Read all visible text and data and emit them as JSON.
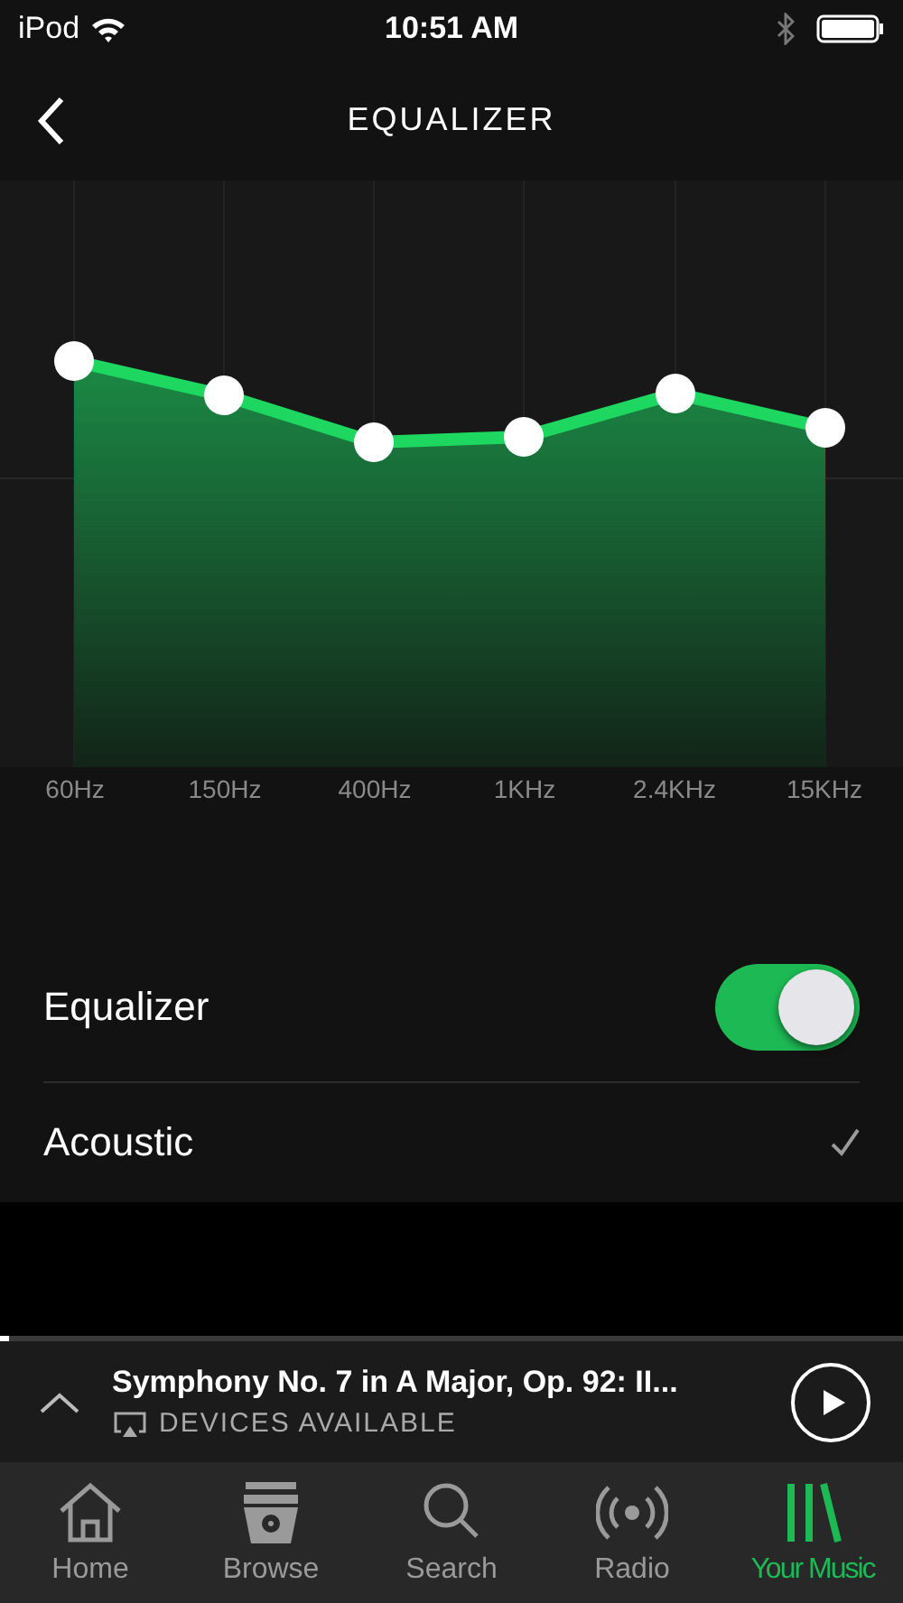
{
  "status_bar": {
    "carrier": "iPod",
    "time": "10:51 AM"
  },
  "nav": {
    "title": "EQUALIZER"
  },
  "bands": [
    "60Hz",
    "150Hz",
    "400Hz",
    "1KHz",
    "2.4KHz",
    "15KHz"
  ],
  "settings": [
    {
      "kind": "toggle",
      "label": "Equalizer",
      "on": true
    },
    {
      "kind": "preset",
      "label": "Acoustic",
      "checked": true
    }
  ],
  "player": {
    "title": "Symphony No. 7 in A Major, Op. 92: II...",
    "subtitle": "DEVICES AVAILABLE",
    "level": 0.01
  },
  "tabs": [
    {
      "label": "Home",
      "selected": false
    },
    {
      "label": "Browse",
      "selected": false
    },
    {
      "label": "Search",
      "selected": false
    },
    {
      "label": "Radio",
      "selected": false
    },
    {
      "label": "Your Music",
      "selected": true
    }
  ]
}
